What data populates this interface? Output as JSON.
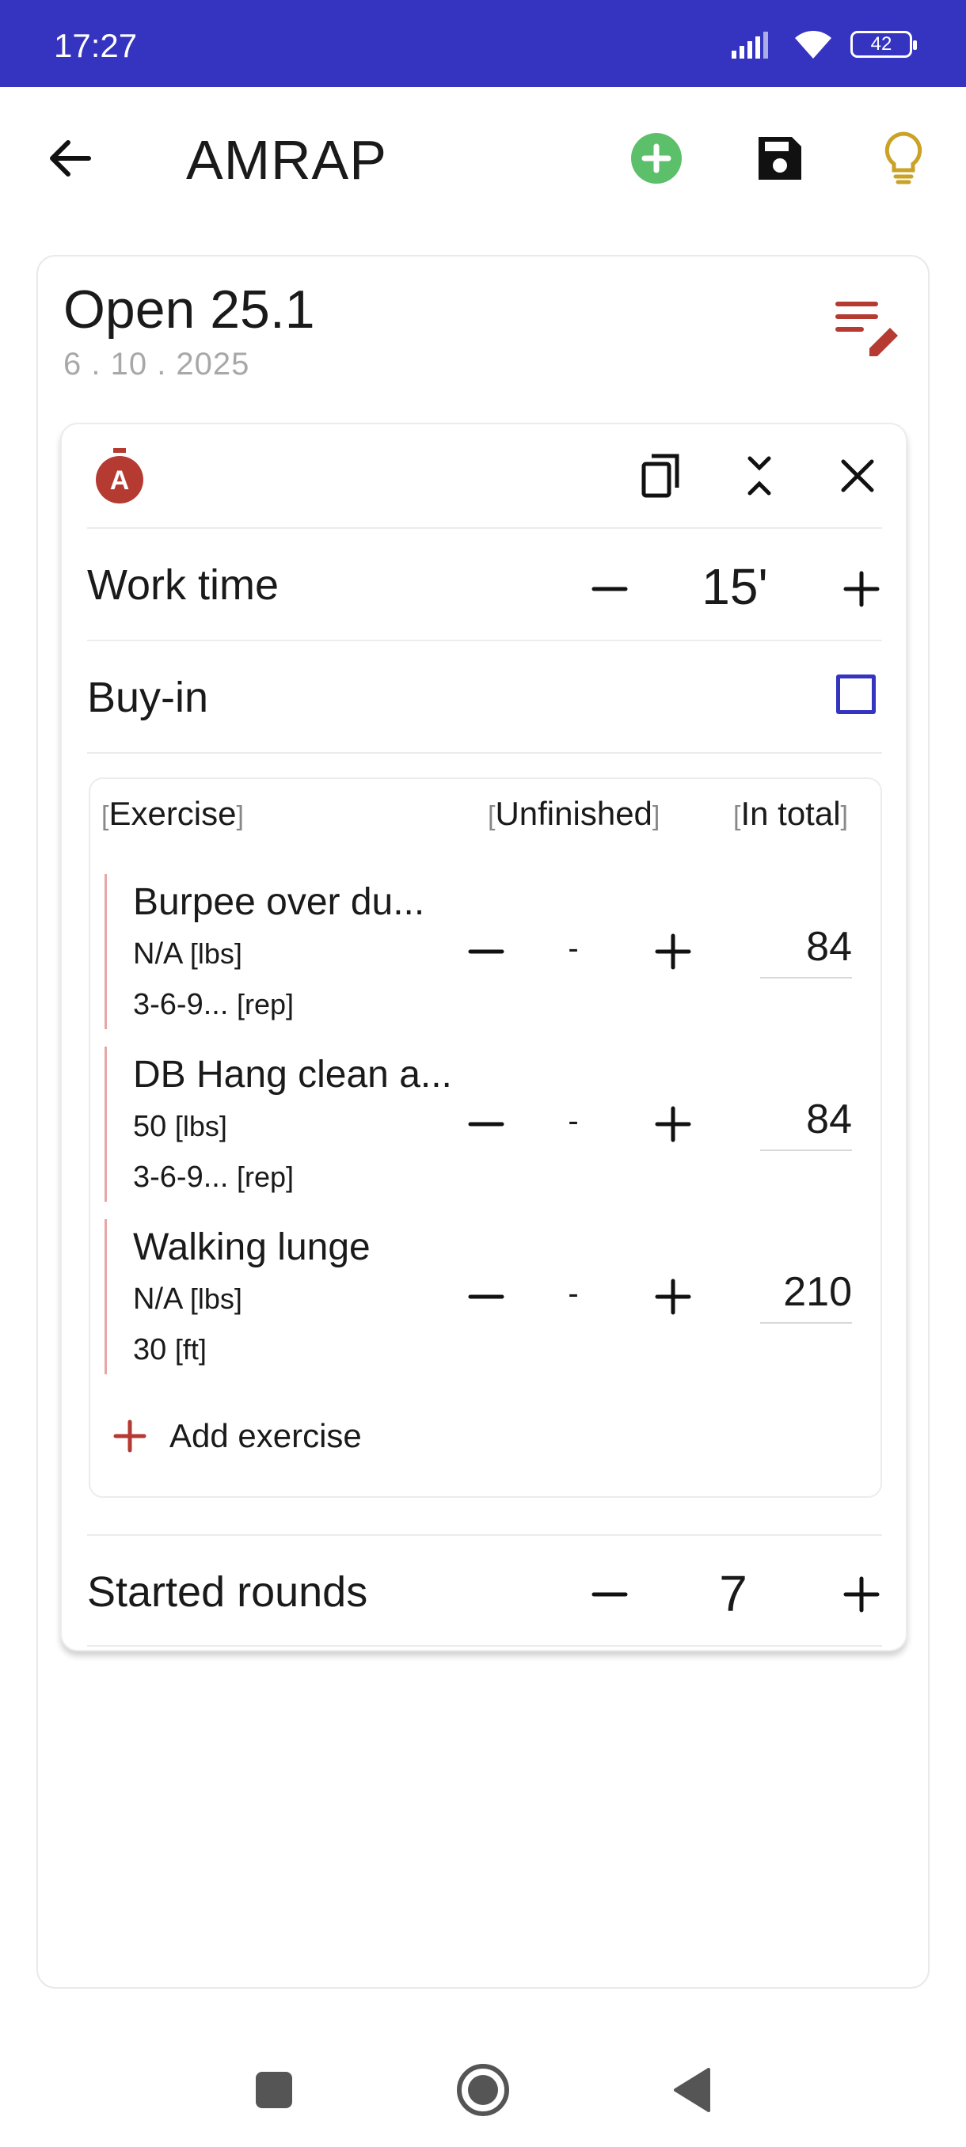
{
  "status_bar": {
    "time": "17:27",
    "battery": "42"
  },
  "app_bar": {
    "title": "AMRAP"
  },
  "workout": {
    "name": "Open 25.1",
    "date": "6 . 10 . 2025"
  },
  "block": {
    "work_time": {
      "label": "Work time",
      "value": "15'"
    },
    "buy_in": {
      "label": "Buy-in",
      "checked": false
    },
    "columns": {
      "exercise": "Exercise",
      "unfinished": "Unfinished",
      "in_total": "In total",
      "open": "[",
      "close": "]"
    },
    "exercises": [
      {
        "name": "Burpee over du...",
        "weight": "N/A",
        "weight_unit": "[lbs]",
        "reps": "3-6-9...",
        "reps_unit": "[rep]",
        "unfinished": "-",
        "total": "84"
      },
      {
        "name": "DB Hang clean a...",
        "weight": "50",
        "weight_unit": "[lbs]",
        "reps": "3-6-9...",
        "reps_unit": "[rep]",
        "unfinished": "-",
        "total": "84"
      },
      {
        "name": "Walking lunge",
        "weight": "N/A",
        "weight_unit": "[lbs]",
        "reps": "30",
        "reps_unit": "[ft]",
        "unfinished": "-",
        "total": "210"
      }
    ],
    "add_exercise": "Add exercise",
    "started_rounds": {
      "label": "Started rounds",
      "value": "7"
    }
  },
  "colors": {
    "accent": "#3434c0",
    "red": "#b53a32",
    "green": "#5cbf6a",
    "gold": "#c9a227"
  }
}
